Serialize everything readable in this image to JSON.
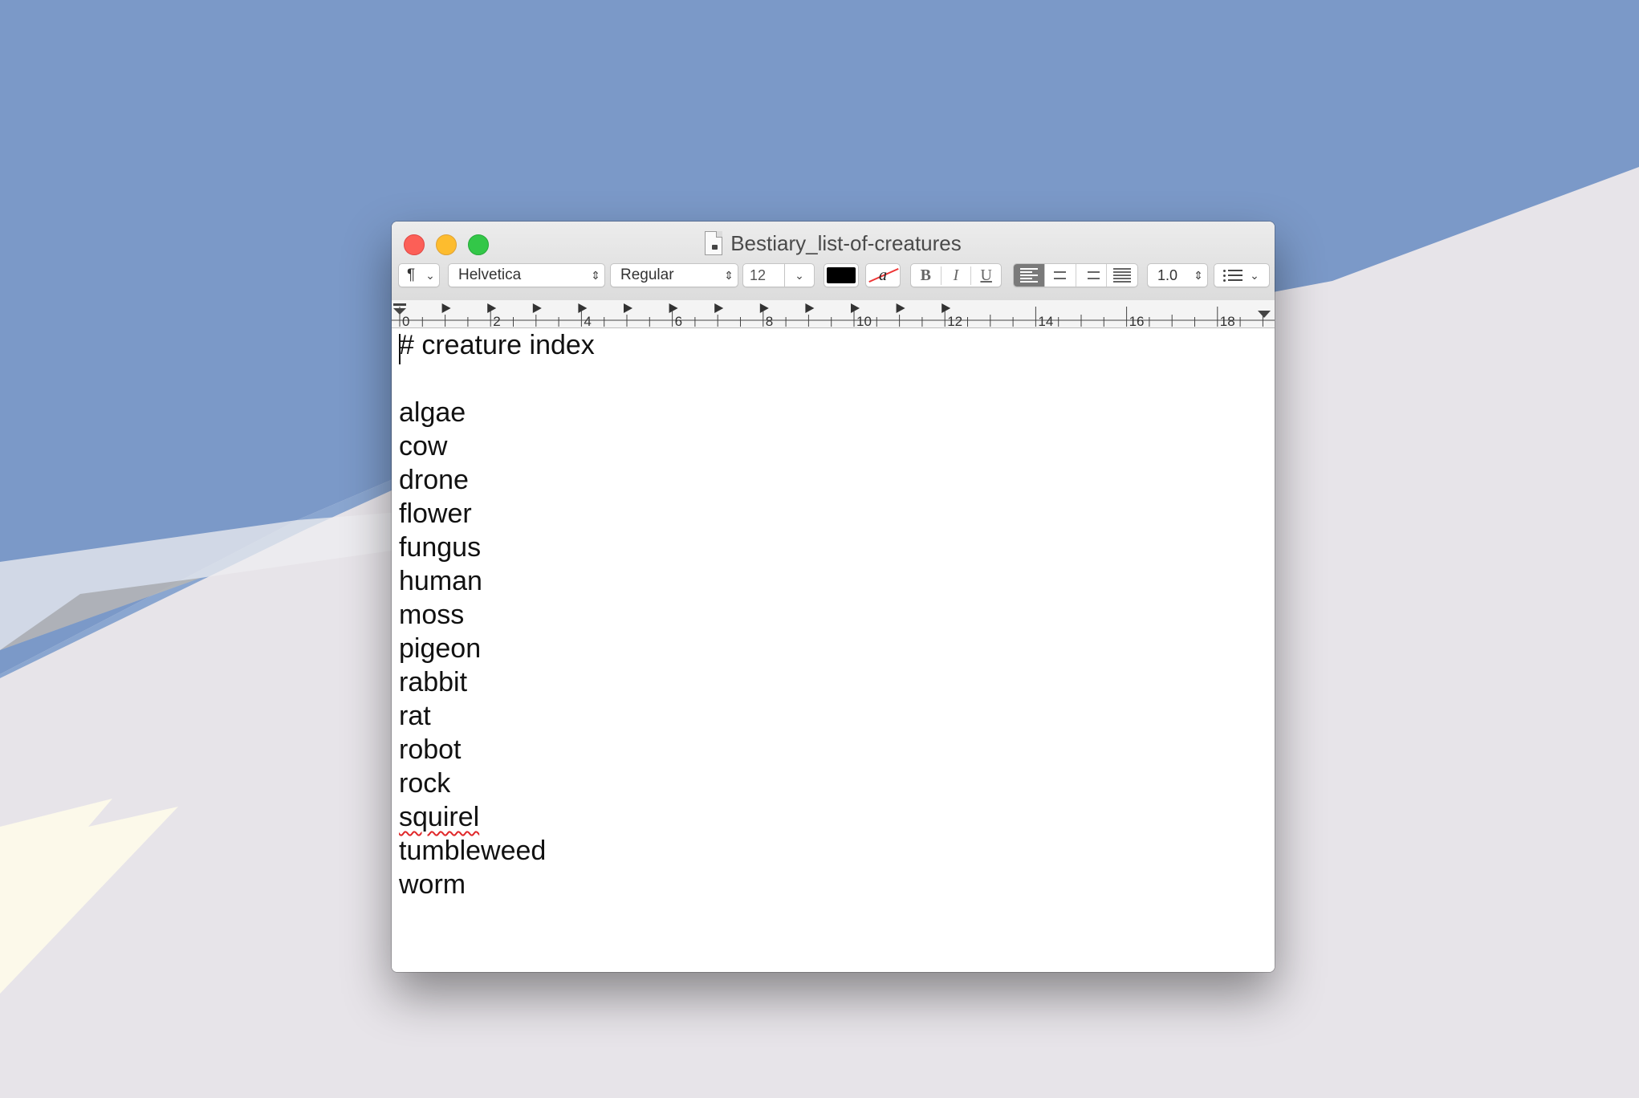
{
  "window": {
    "title": "Bestiary_list-of-creatures"
  },
  "toolbar": {
    "paragraph_symbol": "¶",
    "font_family": "Helvetica",
    "font_style": "Regular",
    "font_size": "12",
    "text_color": "#000000",
    "highlight_letter": "a",
    "bold_label": "B",
    "italic_label": "I",
    "underline_label": "U",
    "alignment_options": [
      "left",
      "center",
      "right",
      "justify"
    ],
    "alignment_selected": "left",
    "line_spacing": "1.0"
  },
  "ruler": {
    "labels": [
      "0",
      "2",
      "4",
      "6",
      "8",
      "10",
      "12",
      "14",
      "16",
      "18"
    ]
  },
  "document": {
    "heading": "# creature index",
    "items": [
      "algae",
      "cow",
      "drone",
      "flower",
      "fungus",
      "human",
      "moss",
      "pigeon",
      "rabbit",
      "rat",
      "robot",
      "rock",
      "squirel",
      "tumbleweed",
      "worm"
    ],
    "misspelled_word": "squirel"
  },
  "colors": {
    "desktop_sky": "#7b99c8",
    "desktop_ground": "#e7e4e9",
    "desktop_highlight": "#fcf9ea",
    "close_button": "#fc5f57",
    "minimize_button": "#fdbc2e",
    "maximize_button": "#33c748"
  }
}
